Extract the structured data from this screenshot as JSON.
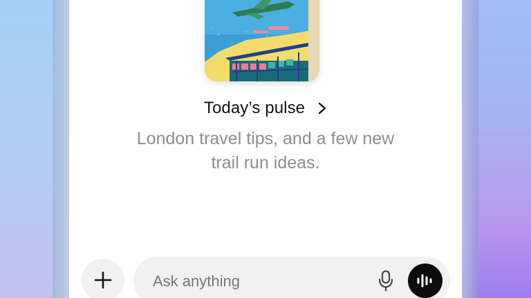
{
  "pulse": {
    "title": "Today’s pulse",
    "summary": "London travel tips, and a few new trail run ideas.",
    "card_image": "illustration-of-airplane-and-station"
  },
  "composer": {
    "placeholder": "Ask anything",
    "add_icon": "plus-icon",
    "mic_icon": "microphone-icon",
    "voice_icon": "voice-waveform-icon"
  },
  "colors": {
    "title": "#111111",
    "summary": "#8e8e8e",
    "composer_bg": "#f1f1f1",
    "voice_button": "#0d0d0d"
  }
}
